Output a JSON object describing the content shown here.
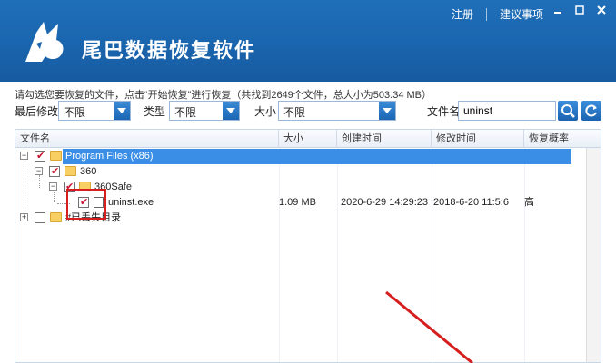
{
  "header": {
    "title": "尾巴数据恢复软件",
    "links": [
      "注册",
      "建议事项"
    ],
    "window_controls": [
      "minimize-icon",
      "maximize-icon",
      "close-icon"
    ]
  },
  "info_text": "请勾选您要恢复的文件，点击“开始恢复”进行恢复（共找到2649个文件，总大小为503.34 MB）",
  "filters": {
    "modified_label": "最后修改",
    "modified_value": "不限",
    "type_label": "类型",
    "type_value": "不限",
    "size_label": "大小",
    "size_value": "不限",
    "filename_label": "文件名",
    "filename_value": "uninst",
    "search_icon": "search-icon",
    "refresh_icon": "refresh-icon"
  },
  "table": {
    "columns": [
      "文件名",
      "大小",
      "创建时间",
      "修改时间",
      "恢复概率"
    ],
    "rows": [
      {
        "name": "Program Files (x86)",
        "size": "",
        "created": "",
        "modified": "",
        "prob": "",
        "checked": true,
        "expanded": true
      },
      {
        "name": "360",
        "size": "",
        "created": "",
        "modified": "",
        "prob": "",
        "checked": true,
        "expanded": true
      },
      {
        "name": "360Safe",
        "size": "",
        "created": "",
        "modified": "",
        "prob": "",
        "checked": true,
        "expanded": true
      },
      {
        "name": "uninst.exe",
        "size": "1.09 MB",
        "created": "2020-6-29 14:29:23",
        "modified": "2018-6-20 11:5:6",
        "prob": "高",
        "checked": true
      },
      {
        "name": "#已丢失目录",
        "size": "",
        "created": "",
        "modified": "",
        "prob": "",
        "checked": false,
        "expanded": false
      }
    ]
  },
  "colors": {
    "titlebar": "#1a65ae",
    "selection": "#3a8ee6",
    "highlight_box": "#d61e1e",
    "annotation_arrow": "#d61e1e"
  }
}
